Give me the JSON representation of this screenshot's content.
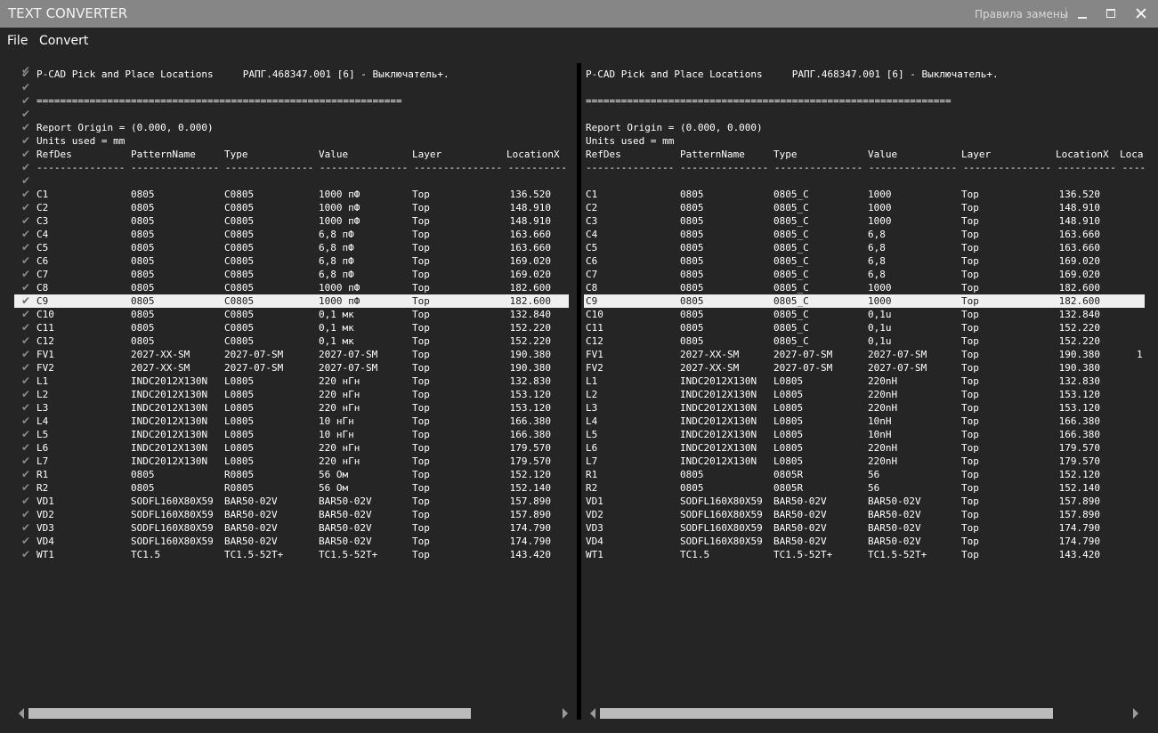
{
  "window": {
    "title": "TEXT CONVERTER",
    "rules_link": "Правила замены",
    "controls": [
      "minimize",
      "maximize",
      "close"
    ]
  },
  "menu": {
    "items": [
      {
        "label": "File"
      },
      {
        "label": "Convert"
      }
    ]
  },
  "left_panel": {
    "header_lines": [
      "P-CAD Pick and Place Locations     РАПГ.468347.001 [6] - Выключатель+.",
      "",
      "==============================================================",
      "",
      "Report Origin = (0.000, 0.000)",
      "Units used = mm"
    ],
    "columns": [
      "RefDes",
      "PatternName",
      "Type",
      "Value",
      "Layer",
      "LocationX"
    ],
    "dashes": "--------------- --------------- --------------- --------------- --------------- ----------",
    "rows": [
      [
        "C1",
        "0805",
        "C0805",
        "1000 пФ",
        "Top",
        "136.520"
      ],
      [
        "C2",
        "0805",
        "C0805",
        "1000 пФ",
        "Top",
        "148.910"
      ],
      [
        "C3",
        "0805",
        "C0805",
        "1000 пФ",
        "Top",
        "148.910"
      ],
      [
        "C4",
        "0805",
        "C0805",
        "6,8 пФ",
        "Top",
        "163.660"
      ],
      [
        "C5",
        "0805",
        "C0805",
        "6,8 пФ",
        "Top",
        "163.660"
      ],
      [
        "C6",
        "0805",
        "C0805",
        "6,8 пФ",
        "Top",
        "169.020"
      ],
      [
        "C7",
        "0805",
        "C0805",
        "6,8 пФ",
        "Top",
        "169.020"
      ],
      [
        "C8",
        "0805",
        "C0805",
        "1000 пФ",
        "Top",
        "182.600"
      ],
      [
        "C9",
        "0805",
        "C0805",
        "1000 пФ",
        "Top",
        "182.600"
      ],
      [
        "C10",
        "0805",
        "C0805",
        "0,1 мк",
        "Top",
        "132.840"
      ],
      [
        "C11",
        "0805",
        "C0805",
        "0,1 мк",
        "Top",
        "152.220"
      ],
      [
        "C12",
        "0805",
        "C0805",
        "0,1 мк",
        "Top",
        "152.220"
      ],
      [
        "FV1",
        "2027-XX-SM",
        "2027-07-SM",
        "2027-07-SM",
        "Top",
        "190.380"
      ],
      [
        "FV2",
        "2027-XX-SM",
        "2027-07-SM",
        "2027-07-SM",
        "Top",
        "190.380"
      ],
      [
        "L1",
        "INDC2012X130N",
        "L0805",
        "220 нГн",
        "Top",
        "132.830"
      ],
      [
        "L2",
        "INDC2012X130N",
        "L0805",
        "220 нГн",
        "Top",
        "153.120"
      ],
      [
        "L3",
        "INDC2012X130N",
        "L0805",
        "220 нГн",
        "Top",
        "153.120"
      ],
      [
        "L4",
        "INDC2012X130N",
        "L0805",
        "10 нГн",
        "Top",
        "166.380"
      ],
      [
        "L5",
        "INDC2012X130N",
        "L0805",
        "10 нГн",
        "Top",
        "166.380"
      ],
      [
        "L6",
        "INDC2012X130N",
        "L0805",
        "220 нГн",
        "Top",
        "179.570"
      ],
      [
        "L7",
        "INDC2012X130N",
        "L0805",
        "220 нГн",
        "Top",
        "179.570"
      ],
      [
        "R1",
        "0805",
        "R0805",
        "56 Ом",
        "Top",
        "152.120"
      ],
      [
        "R2",
        "0805",
        "R0805",
        "56 Ом",
        "Top",
        "152.140"
      ],
      [
        "VD1",
        "SODFL160X80X59",
        "BAR50-02V",
        "BAR50-02V",
        "Top",
        "157.890"
      ],
      [
        "VD2",
        "SODFL160X80X59",
        "BAR50-02V",
        "BAR50-02V",
        "Top",
        "157.890"
      ],
      [
        "VD3",
        "SODFL160X80X59",
        "BAR50-02V",
        "BAR50-02V",
        "Top",
        "174.790"
      ],
      [
        "VD4",
        "SODFL160X80X59",
        "BAR50-02V",
        "BAR50-02V",
        "Top",
        "174.790"
      ],
      [
        "WT1",
        "TC1.5",
        "TC1.5-52T+",
        "TC1.5-52T+",
        "Top",
        "143.420"
      ]
    ],
    "selected_row": 8,
    "scroll_position": 0.0
  },
  "right_panel": {
    "header_lines": [
      "P-CAD Pick and Place Locations     РАПГ.468347.001 [6] - Выключатель+.",
      "",
      "==============================================================",
      "",
      "Report Origin = (0.000, 0.000)",
      "Units used = mm"
    ],
    "columns": [
      "RefDes",
      "PatternName",
      "Type",
      "Value",
      "Layer",
      "LocationX",
      "Loca"
    ],
    "dashes": "--------------- --------------- --------------- --------------- --------------- ---------- ----",
    "rows": [
      [
        "C1",
        "0805",
        "0805_C",
        "1000",
        "Top",
        "136.520",
        ""
      ],
      [
        "C2",
        "0805",
        "0805_C",
        "1000",
        "Top",
        "148.910",
        ""
      ],
      [
        "C3",
        "0805",
        "0805_C",
        "1000",
        "Top",
        "148.910",
        ""
      ],
      [
        "C4",
        "0805",
        "0805_C",
        "6,8",
        "Top",
        "163.660",
        ""
      ],
      [
        "C5",
        "0805",
        "0805_C",
        "6,8",
        "Top",
        "163.660",
        ""
      ],
      [
        "C6",
        "0805",
        "0805_C",
        "6,8",
        "Top",
        "169.020",
        ""
      ],
      [
        "C7",
        "0805",
        "0805_C",
        "6,8",
        "Top",
        "169.020",
        ""
      ],
      [
        "C8",
        "0805",
        "0805_C",
        "1000",
        "Top",
        "182.600",
        ""
      ],
      [
        "C9",
        "0805",
        "0805_C",
        "1000",
        "Top",
        "182.600",
        ""
      ],
      [
        "C10",
        "0805",
        "0805_C",
        "0,1u",
        "Top",
        "132.840",
        ""
      ],
      [
        "C11",
        "0805",
        "0805_C",
        "0,1u",
        "Top",
        "152.220",
        ""
      ],
      [
        "C12",
        "0805",
        "0805_C",
        "0,1u",
        "Top",
        "152.220",
        ""
      ],
      [
        "FV1",
        "2027-XX-SM",
        "2027-07-SM",
        "2027-07-SM",
        "Top",
        "190.380",
        "1"
      ],
      [
        "FV2",
        "2027-XX-SM",
        "2027-07-SM",
        "2027-07-SM",
        "Top",
        "190.380",
        ""
      ],
      [
        "L1",
        "INDC2012X130N",
        "L0805",
        "220nH",
        "Top",
        "132.830",
        ""
      ],
      [
        "L2",
        "INDC2012X130N",
        "L0805",
        "220nH",
        "Top",
        "153.120",
        ""
      ],
      [
        "L3",
        "INDC2012X130N",
        "L0805",
        "220nH",
        "Top",
        "153.120",
        ""
      ],
      [
        "L4",
        "INDC2012X130N",
        "L0805",
        "10nH",
        "Top",
        "166.380",
        ""
      ],
      [
        "L5",
        "INDC2012X130N",
        "L0805",
        "10nH",
        "Top",
        "166.380",
        ""
      ],
      [
        "L6",
        "INDC2012X130N",
        "L0805",
        "220nH",
        "Top",
        "179.570",
        ""
      ],
      [
        "L7",
        "INDC2012X130N",
        "L0805",
        "220nH",
        "Top",
        "179.570",
        ""
      ],
      [
        "R1",
        "0805",
        "0805R",
        "56",
        "Top",
        "152.120",
        ""
      ],
      [
        "R2",
        "0805",
        "0805R",
        "56",
        "Top",
        "152.140",
        ""
      ],
      [
        "VD1",
        "SODFL160X80X59",
        "BAR50-02V",
        "BAR50-02V",
        "Top",
        "157.890",
        ""
      ],
      [
        "VD2",
        "SODFL160X80X59",
        "BAR50-02V",
        "BAR50-02V",
        "Top",
        "157.890",
        ""
      ],
      [
        "VD3",
        "SODFL160X80X59",
        "BAR50-02V",
        "BAR50-02V",
        "Top",
        "174.790",
        ""
      ],
      [
        "VD4",
        "SODFL160X80X59",
        "BAR50-02V",
        "BAR50-02V",
        "Top",
        "174.790",
        ""
      ],
      [
        "WT1",
        "TC1.5",
        "TC1.5-52T+",
        "TC1.5-52T+",
        "Top",
        "143.420",
        ""
      ]
    ],
    "selected_row": 8,
    "scroll_position": 0.0
  },
  "icons": {
    "row_check": "check-icon",
    "scroll_left": "triangle-left",
    "scroll_right": "triangle-right"
  },
  "colors": {
    "background": "#252525",
    "titlebar": "#868686",
    "selection": "#f0f0f0",
    "text": "#ffffff",
    "scroll_thumb": "#bbbbbb"
  }
}
